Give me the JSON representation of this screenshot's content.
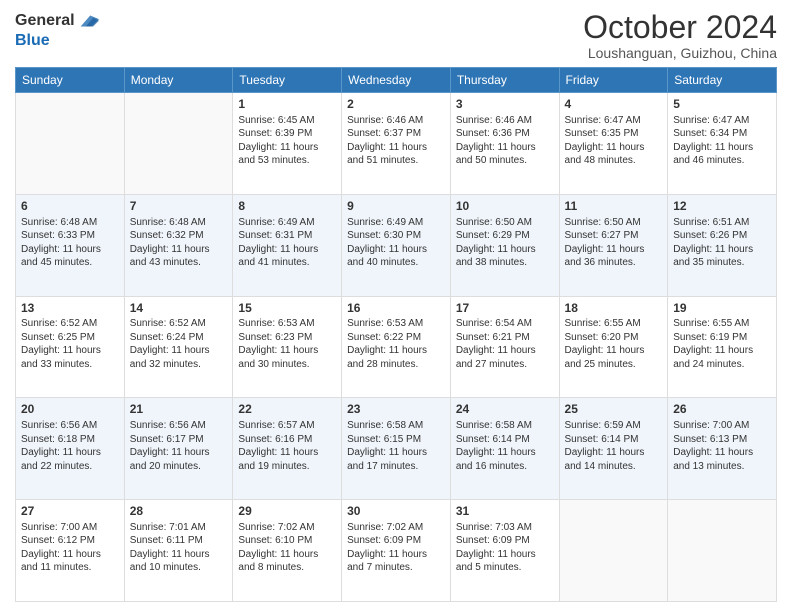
{
  "header": {
    "logo": {
      "general": "General",
      "blue": "Blue"
    },
    "month_year": "October 2024",
    "location": "Loushanguan, Guizhou, China"
  },
  "weekdays": [
    "Sunday",
    "Monday",
    "Tuesday",
    "Wednesday",
    "Thursday",
    "Friday",
    "Saturday"
  ],
  "weeks": [
    [
      {
        "day": "",
        "info": ""
      },
      {
        "day": "",
        "info": ""
      },
      {
        "day": "1",
        "info": "Sunrise: 6:45 AM\nSunset: 6:39 PM\nDaylight: 11 hours\nand 53 minutes."
      },
      {
        "day": "2",
        "info": "Sunrise: 6:46 AM\nSunset: 6:37 PM\nDaylight: 11 hours\nand 51 minutes."
      },
      {
        "day": "3",
        "info": "Sunrise: 6:46 AM\nSunset: 6:36 PM\nDaylight: 11 hours\nand 50 minutes."
      },
      {
        "day": "4",
        "info": "Sunrise: 6:47 AM\nSunset: 6:35 PM\nDaylight: 11 hours\nand 48 minutes."
      },
      {
        "day": "5",
        "info": "Sunrise: 6:47 AM\nSunset: 6:34 PM\nDaylight: 11 hours\nand 46 minutes."
      }
    ],
    [
      {
        "day": "6",
        "info": "Sunrise: 6:48 AM\nSunset: 6:33 PM\nDaylight: 11 hours\nand 45 minutes."
      },
      {
        "day": "7",
        "info": "Sunrise: 6:48 AM\nSunset: 6:32 PM\nDaylight: 11 hours\nand 43 minutes."
      },
      {
        "day": "8",
        "info": "Sunrise: 6:49 AM\nSunset: 6:31 PM\nDaylight: 11 hours\nand 41 minutes."
      },
      {
        "day": "9",
        "info": "Sunrise: 6:49 AM\nSunset: 6:30 PM\nDaylight: 11 hours\nand 40 minutes."
      },
      {
        "day": "10",
        "info": "Sunrise: 6:50 AM\nSunset: 6:29 PM\nDaylight: 11 hours\nand 38 minutes."
      },
      {
        "day": "11",
        "info": "Sunrise: 6:50 AM\nSunset: 6:27 PM\nDaylight: 11 hours\nand 36 minutes."
      },
      {
        "day": "12",
        "info": "Sunrise: 6:51 AM\nSunset: 6:26 PM\nDaylight: 11 hours\nand 35 minutes."
      }
    ],
    [
      {
        "day": "13",
        "info": "Sunrise: 6:52 AM\nSunset: 6:25 PM\nDaylight: 11 hours\nand 33 minutes."
      },
      {
        "day": "14",
        "info": "Sunrise: 6:52 AM\nSunset: 6:24 PM\nDaylight: 11 hours\nand 32 minutes."
      },
      {
        "day": "15",
        "info": "Sunrise: 6:53 AM\nSunset: 6:23 PM\nDaylight: 11 hours\nand 30 minutes."
      },
      {
        "day": "16",
        "info": "Sunrise: 6:53 AM\nSunset: 6:22 PM\nDaylight: 11 hours\nand 28 minutes."
      },
      {
        "day": "17",
        "info": "Sunrise: 6:54 AM\nSunset: 6:21 PM\nDaylight: 11 hours\nand 27 minutes."
      },
      {
        "day": "18",
        "info": "Sunrise: 6:55 AM\nSunset: 6:20 PM\nDaylight: 11 hours\nand 25 minutes."
      },
      {
        "day": "19",
        "info": "Sunrise: 6:55 AM\nSunset: 6:19 PM\nDaylight: 11 hours\nand 24 minutes."
      }
    ],
    [
      {
        "day": "20",
        "info": "Sunrise: 6:56 AM\nSunset: 6:18 PM\nDaylight: 11 hours\nand 22 minutes."
      },
      {
        "day": "21",
        "info": "Sunrise: 6:56 AM\nSunset: 6:17 PM\nDaylight: 11 hours\nand 20 minutes."
      },
      {
        "day": "22",
        "info": "Sunrise: 6:57 AM\nSunset: 6:16 PM\nDaylight: 11 hours\nand 19 minutes."
      },
      {
        "day": "23",
        "info": "Sunrise: 6:58 AM\nSunset: 6:15 PM\nDaylight: 11 hours\nand 17 minutes."
      },
      {
        "day": "24",
        "info": "Sunrise: 6:58 AM\nSunset: 6:14 PM\nDaylight: 11 hours\nand 16 minutes."
      },
      {
        "day": "25",
        "info": "Sunrise: 6:59 AM\nSunset: 6:14 PM\nDaylight: 11 hours\nand 14 minutes."
      },
      {
        "day": "26",
        "info": "Sunrise: 7:00 AM\nSunset: 6:13 PM\nDaylight: 11 hours\nand 13 minutes."
      }
    ],
    [
      {
        "day": "27",
        "info": "Sunrise: 7:00 AM\nSunset: 6:12 PM\nDaylight: 11 hours\nand 11 minutes."
      },
      {
        "day": "28",
        "info": "Sunrise: 7:01 AM\nSunset: 6:11 PM\nDaylight: 11 hours\nand 10 minutes."
      },
      {
        "day": "29",
        "info": "Sunrise: 7:02 AM\nSunset: 6:10 PM\nDaylight: 11 hours\nand 8 minutes."
      },
      {
        "day": "30",
        "info": "Sunrise: 7:02 AM\nSunset: 6:09 PM\nDaylight: 11 hours\nand 7 minutes."
      },
      {
        "day": "31",
        "info": "Sunrise: 7:03 AM\nSunset: 6:09 PM\nDaylight: 11 hours\nand 5 minutes."
      },
      {
        "day": "",
        "info": ""
      },
      {
        "day": "",
        "info": ""
      }
    ]
  ]
}
